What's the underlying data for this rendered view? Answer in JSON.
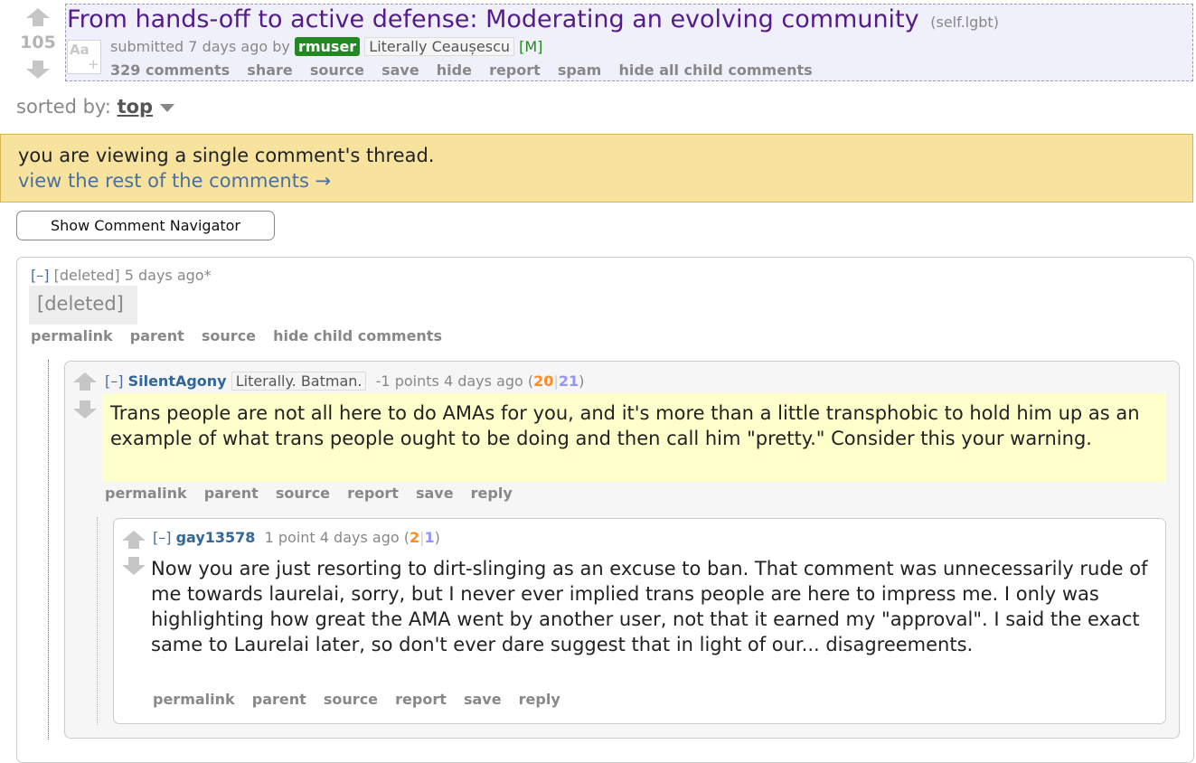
{
  "post": {
    "score": "105",
    "title": "From hands-off to active defense: Moderating an evolving community",
    "domain": "(self.lgbt)",
    "thumbnail_label": "Aa",
    "submitted_prefix": "submitted 7 days ago by",
    "author": "rmuser",
    "author_flair": "Literally Ceaușescu",
    "mod_marker": "[M]",
    "buttons": [
      "329 comments",
      "share",
      "source",
      "save",
      "hide",
      "report",
      "spam",
      "hide all child comments"
    ]
  },
  "sort": {
    "label": "sorted by:",
    "value": "top"
  },
  "notice": {
    "line1": "you are viewing a single comment's thread.",
    "link": "view the rest of the comments →"
  },
  "navigator_button": "Show Comment Navigator",
  "comments": [
    {
      "collapse": "[–]",
      "author": "[deleted]",
      "time": "5 days ago*",
      "body": "[deleted]",
      "buttons": [
        "permalink",
        "parent",
        "source",
        "hide child comments"
      ]
    },
    {
      "collapse": "[–]",
      "author": "SilentAgony",
      "flair": "Literally. Batman.",
      "points": "-1 points",
      "time": "4 days ago",
      "up": "20",
      "down": "21",
      "body": "Trans people are not all here to do AMAs for you, and it's more than a little transphobic to hold him up as an example of what trans people ought to be doing and then call him \"pretty.\" Consider this your warning.",
      "buttons": [
        "permalink",
        "parent",
        "source",
        "report",
        "save",
        "reply"
      ]
    },
    {
      "collapse": "[–]",
      "author": "gay13578",
      "points": "1 point",
      "time": "4 days ago",
      "up": "2",
      "down": "1",
      "body": "Now you are just resorting to dirt-slinging as an excuse to ban. That comment was unnecessarily rude of me towards laurelai, sorry, but I never ever implied trans people are here to impress me. I only was highlighting how great the AMA went by another user, not that it earned my \"approval\". I said the exact same to Laurelai later, so don't ever dare suggest that in light of our... disagreements.",
      "buttons": [
        "permalink",
        "parent",
        "source",
        "report",
        "save",
        "reply"
      ]
    }
  ],
  "colors": {
    "link": "#4a6fa0",
    "author": "#336699",
    "upvotes": "#ff8b24",
    "downvotes": "#9494ff",
    "notice_bg": "#f7e29e",
    "highlight_bg": "#ffffcc",
    "title": "#551a8b"
  },
  "icons": {
    "upvote": "upvote-arrow-icon",
    "downvote": "downvote-arrow-icon"
  }
}
